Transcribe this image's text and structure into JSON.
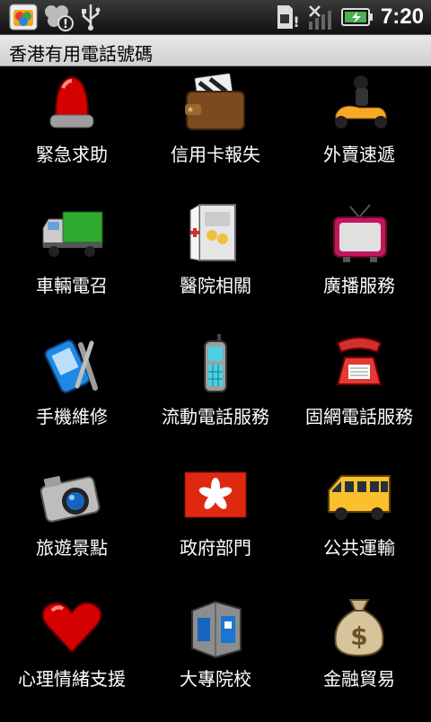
{
  "status_bar": {
    "time": "7:20",
    "left_icons": [
      "app-store-icon",
      "notification-alert-icon",
      "usb-icon"
    ],
    "right_icons": [
      "sim-alert-icon",
      "no-signal-icon",
      "signal-bars-icon",
      "battery-charging-icon"
    ]
  },
  "title": "香港有用電話號碼",
  "items": [
    {
      "label": "緊急求助",
      "icon": "siren-icon"
    },
    {
      "label": "信用卡報失",
      "icon": "wallet-icon"
    },
    {
      "label": "外賣速遞",
      "icon": "scooter-icon"
    },
    {
      "label": "車輛電召",
      "icon": "truck-icon"
    },
    {
      "label": "醫院相關",
      "icon": "medical-cabinet-icon"
    },
    {
      "label": "廣播服務",
      "icon": "television-icon"
    },
    {
      "label": "手機維修",
      "icon": "phone-repair-icon"
    },
    {
      "label": "流動電話服務",
      "icon": "mobile-phone-icon"
    },
    {
      "label": "固網電話服務",
      "icon": "landline-phone-icon"
    },
    {
      "label": "旅遊景點",
      "icon": "camera-icon"
    },
    {
      "label": "政府部門",
      "icon": "hk-flag-icon"
    },
    {
      "label": "公共運輸",
      "icon": "bus-icon"
    },
    {
      "label": "心理情緒支援",
      "icon": "heart-icon"
    },
    {
      "label": "大專院校",
      "icon": "building-icon"
    },
    {
      "label": "金融貿易",
      "icon": "money-bag-icon"
    }
  ]
}
